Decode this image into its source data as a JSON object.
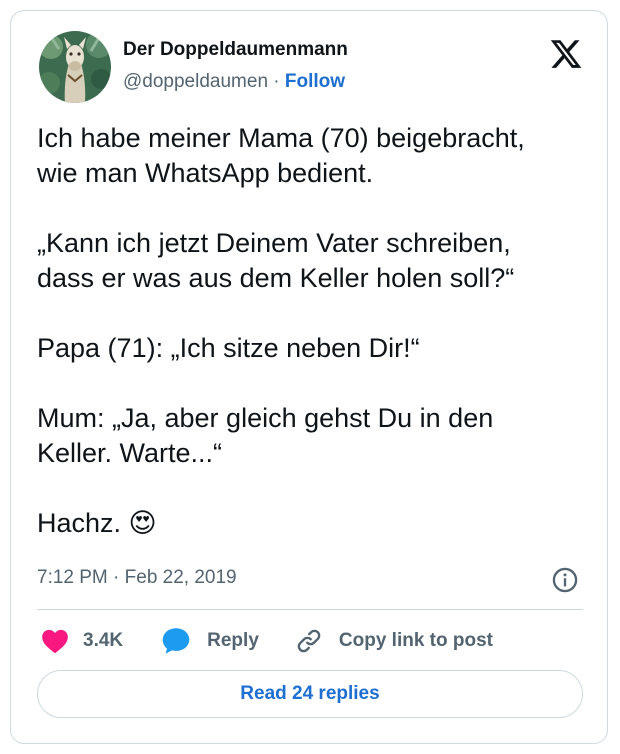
{
  "author": {
    "display_name": "Der Doppeldaumenmann",
    "handle": "@doppeldaumen",
    "separator": "·",
    "follow_label": "Follow"
  },
  "tweet": {
    "text": "Ich habe meiner Mama (70) beigebracht,\nwie man WhatsApp bedient.\n\n„Kann ich jetzt Deinem Vater schreiben,\ndass er was aus dem Keller holen soll?“\n\nPapa (71): „Ich sitze neben Dir!“\n\nMum: „Ja, aber gleich gehst Du in den\nKeller. Warte...“\n\nHachz. 😍",
    "timestamp": "7:12 PM · Feb 22, 2019"
  },
  "actions": {
    "like_count": "3.4K",
    "reply_label": "Reply",
    "copy_link_label": "Copy link to post"
  },
  "read_replies_label": "Read 24 replies",
  "icons": {
    "brand": "x-logo-icon",
    "like": "heart-icon",
    "reply": "speech-bubble-icon",
    "copy": "link-icon",
    "info": "info-icon"
  },
  "colors": {
    "like": "#f91880",
    "reply": "#1d9bf0",
    "link": "#1d6fd1",
    "muted": "#536471",
    "border": "#cfd9de",
    "text": "#0f1419"
  }
}
